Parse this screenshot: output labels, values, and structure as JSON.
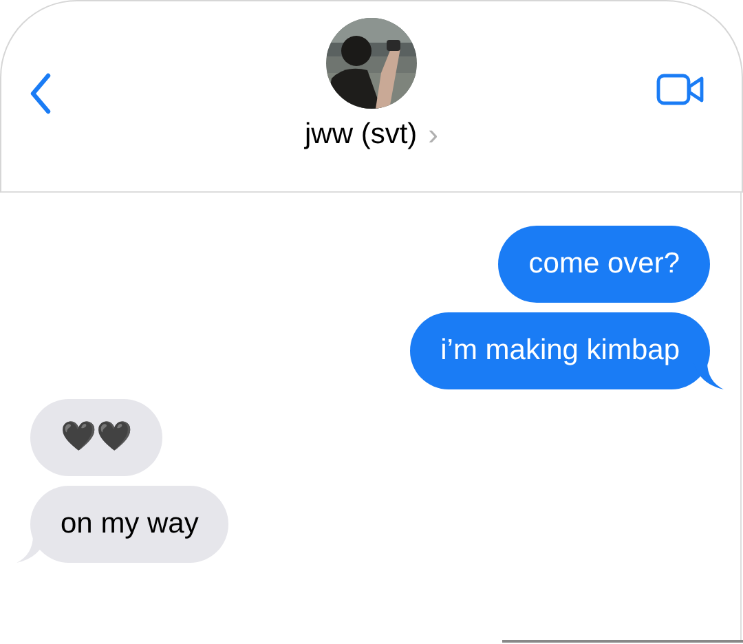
{
  "contact": {
    "name": "jww (svt)",
    "chevron": "›"
  },
  "messages": [
    {
      "kind": "sent",
      "text": "come over?",
      "tail": false
    },
    {
      "kind": "sent",
      "text": "i’m making kimbap",
      "tail": true
    },
    {
      "kind": "received",
      "text": "🖤🖤",
      "tail": false
    },
    {
      "kind": "received",
      "text": "on my way",
      "tail": true
    }
  ]
}
